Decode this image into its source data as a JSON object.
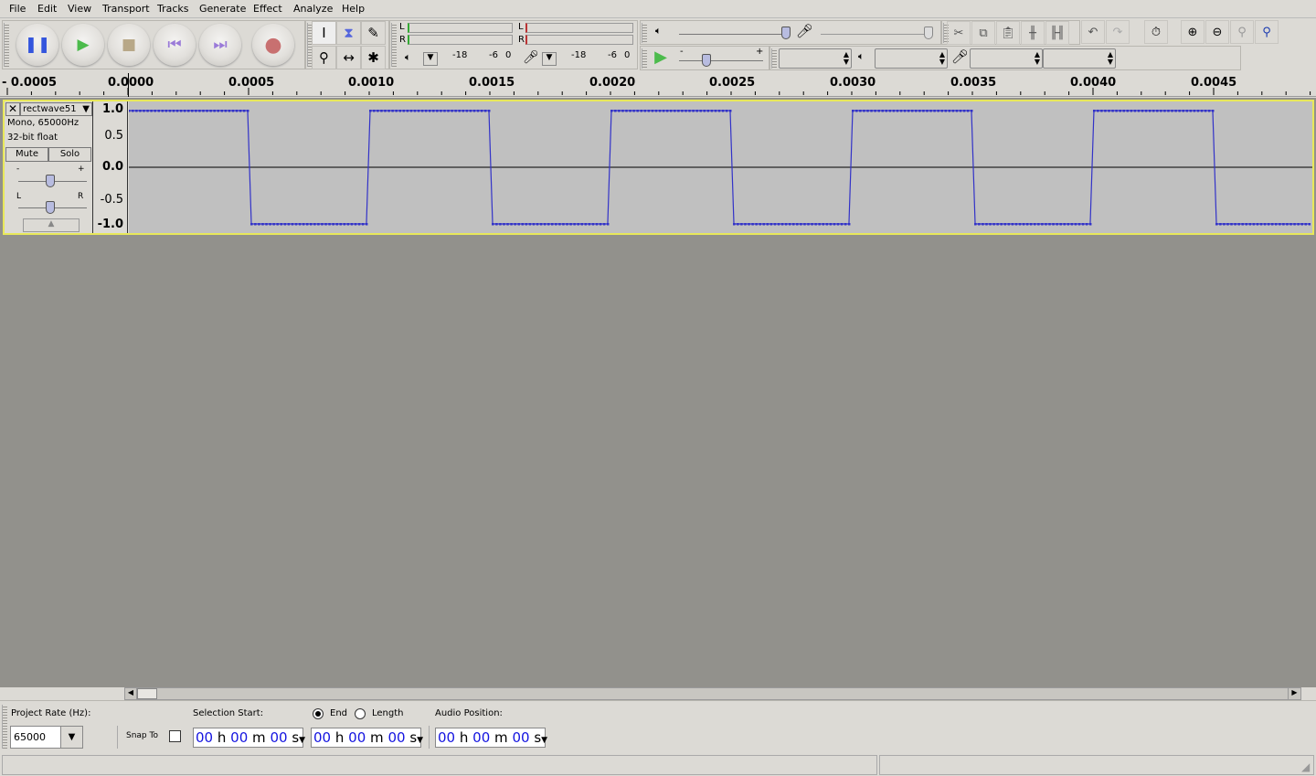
{
  "menu": [
    "File",
    "Edit",
    "View",
    "Transport",
    "Tracks",
    "Generate",
    "Effect",
    "Analyze",
    "Help"
  ],
  "transport": {
    "pause": "Pause",
    "play": "Play",
    "stop": "Stop",
    "skip_start": "Skip to Start",
    "skip_end": "Skip to End",
    "record": "Record"
  },
  "meters": {
    "L": "L",
    "R": "R",
    "ticks": [
      "-18",
      "-6",
      "0"
    ]
  },
  "mixer": {
    "minus": "-",
    "plus": "+"
  },
  "ruler": {
    "labels": [
      "- 0.0005",
      "0.0000",
      "0.0005",
      "0.0010",
      "0.0015",
      "0.0020",
      "0.0025",
      "0.0030",
      "0.0035",
      "0.0040",
      "0.0045"
    ]
  },
  "track": {
    "name": "rectwave51",
    "format": "Mono, 65000Hz",
    "bit_depth": "32-bit float",
    "mute": "Mute",
    "solo": "Solo",
    "gain_minus": "-",
    "gain_plus": "+",
    "pan_l": "L",
    "pan_r": "R",
    "yticks": [
      "1.0",
      "0.5",
      "0.0",
      "-0.5",
      "-1.0"
    ],
    "wave_color": "#3232c8",
    "selection_color": "#e8e85a"
  },
  "selectionbar": {
    "project_rate_label": "Project Rate (Hz):",
    "project_rate": "65000",
    "snap_to": "Snap To",
    "snap_checked": false,
    "selection_start": "Selection Start:",
    "end": "End",
    "length": "Length",
    "end_selected": true,
    "audio_position": "Audio Position:",
    "time": {
      "h": "00",
      "hl": "h",
      "m": "00",
      "ml": "m",
      "s": "00",
      "sl": "s"
    }
  }
}
